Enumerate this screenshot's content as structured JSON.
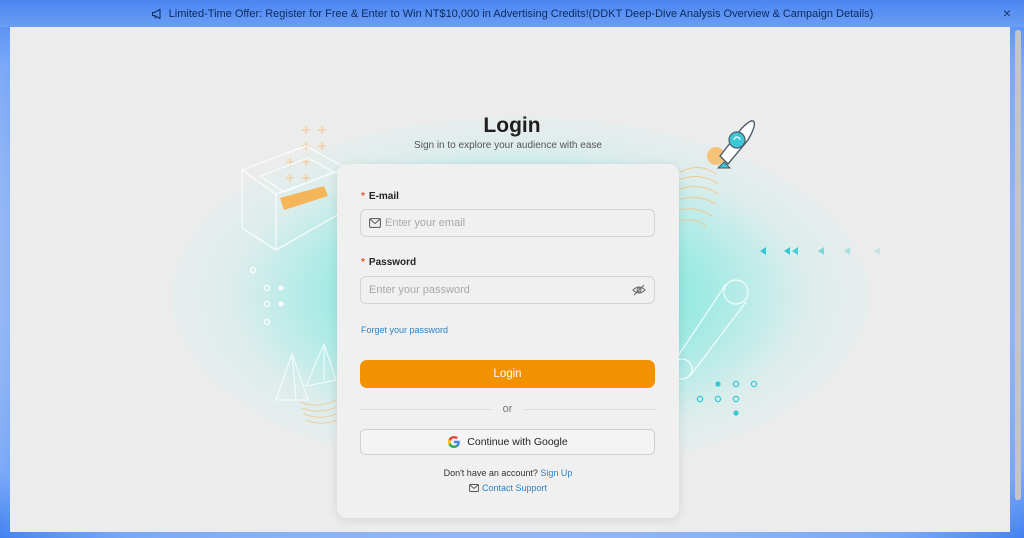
{
  "banner": {
    "text": "Limited-Time Offer: Register for Free & Enter to Win NT$10,000 in Advertising Credits!(DDKT Deep-Dive Analysis Overview & Campaign Details)",
    "close_label": "×"
  },
  "header": {
    "title": "Login",
    "subtitle": "Sign in to explore your audience with ease"
  },
  "form": {
    "email": {
      "label": "E-mail",
      "required_mark": "*",
      "placeholder": "Enter your email",
      "value": ""
    },
    "password": {
      "label": "Password",
      "required_mark": "*",
      "placeholder": "Enter your password",
      "value": ""
    },
    "forgot_label": "Forget your password",
    "login_label": "Login",
    "or_label": "or",
    "google_label": "Continue with Google",
    "signup_prompt": "Don't have an account?",
    "signup_label": "Sign Up",
    "support_label": "Contact Support"
  },
  "icons": {
    "banner": "megaphone-icon",
    "close": "close-icon",
    "email": "mail-icon",
    "password_toggle": "eye-off-icon",
    "google": "google-icon",
    "support": "mail-icon"
  },
  "colors": {
    "accent": "#f39200",
    "link": "#2a82c9",
    "glow": "#36e0d2",
    "banner": "#4a86f2",
    "required": "#e4572e"
  }
}
